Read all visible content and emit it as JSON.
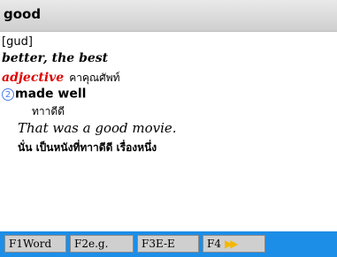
{
  "header": {
    "word": "good"
  },
  "entry": {
    "pronunciation": "[gud]",
    "forms": "better, the best",
    "part_of_speech": "adjective",
    "pos_thai": "คาคุณศัพท์",
    "sense_number": "2",
    "sense_definition": "made well",
    "sense_thai": "ทาาดีดี",
    "example": "That was a good movie.",
    "example_thai": "นั่น เป็นหนังที่ทาาดีดี เรื่องหนึ่ง"
  },
  "function_keys": [
    {
      "key": "F1",
      "label": "Word"
    },
    {
      "key": "F2",
      "label": "e.g."
    },
    {
      "key": "F3",
      "label": "E-E"
    },
    {
      "key": "F4",
      "label": "",
      "icon": "double-arrow-right-icon"
    }
  ],
  "colors": {
    "bottom_bar": "#1c8ee8",
    "pos_red": "#e00000",
    "arrow_yellow": "#f5b800",
    "sense_blue": "#4a7de8"
  }
}
